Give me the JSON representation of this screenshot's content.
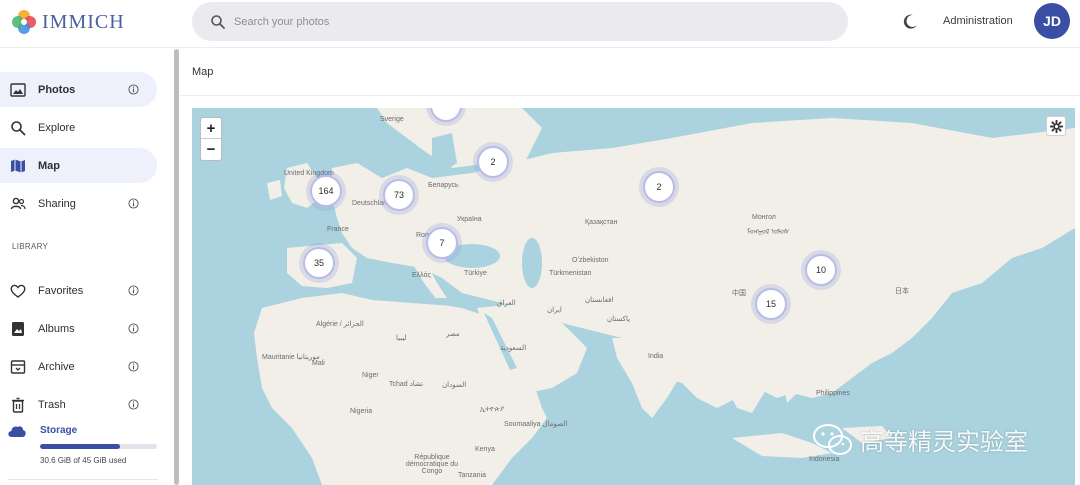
{
  "app": {
    "name": "IMMICH"
  },
  "header": {
    "search_placeholder": "Search your photos",
    "admin_label": "Administration",
    "avatar_initials": "JD"
  },
  "sidebar": {
    "items": [
      {
        "label": "Photos",
        "icon": "photos-icon",
        "info": true
      },
      {
        "label": "Explore",
        "icon": "search-icon",
        "info": false
      },
      {
        "label": "Map",
        "icon": "map-icon",
        "info": false,
        "selected": true
      },
      {
        "label": "Sharing",
        "icon": "people-icon",
        "info": true
      }
    ],
    "library_label": "LIBRARY",
    "library_items": [
      {
        "label": "Favorites",
        "icon": "heart-icon",
        "info": true
      },
      {
        "label": "Albums",
        "icon": "album-icon",
        "info": true
      },
      {
        "label": "Archive",
        "icon": "archive-icon",
        "info": true
      },
      {
        "label": "Trash",
        "icon": "trash-icon",
        "info": true
      }
    ],
    "storage": {
      "label": "Storage",
      "used_text": "30.6 GiB of 45 GiB used",
      "used_fraction": 0.68
    }
  },
  "main": {
    "title": "Map",
    "map": {
      "zoom_in": "+",
      "zoom_out": "−",
      "clusters": [
        "164",
        "73",
        "2",
        "2",
        "7",
        "35",
        "10",
        "15"
      ],
      "labels": [
        "Sverige",
        "United Kingdom",
        "Deutschland",
        "France",
        "Беларусь",
        "Україна",
        "Roma",
        "Ελλάς",
        "Türkiye",
        "Қазақстан",
        "Монгол",
        "ᠮᠣᠩᠭᠣᠯ ᠤᠯᠤᠰ",
        "Oʻzbekiston",
        "Türkmenistan",
        "افغانستان",
        "ایران",
        "العراق",
        "پاکستان",
        "中国",
        "日本",
        "India",
        "Algérie / الجزائر",
        "ليبيا",
        "مصر",
        "السعودية",
        "Mauritanie موريتانيا",
        "Mali",
        "Niger",
        "Tchad تشاد",
        "السودان",
        "Nigeria",
        "ኢትዮጵያ",
        "Soomaaliya الصومال",
        "Kenya",
        "République démocratique du Congo",
        "Tanzania",
        "Philippines",
        "Indonesia"
      ]
    }
  },
  "watermark": {
    "text": "高等精灵实验室"
  },
  "colors": {
    "accent": "#3a4ea3",
    "water": "#aad3df",
    "land": "#f2efe9"
  }
}
